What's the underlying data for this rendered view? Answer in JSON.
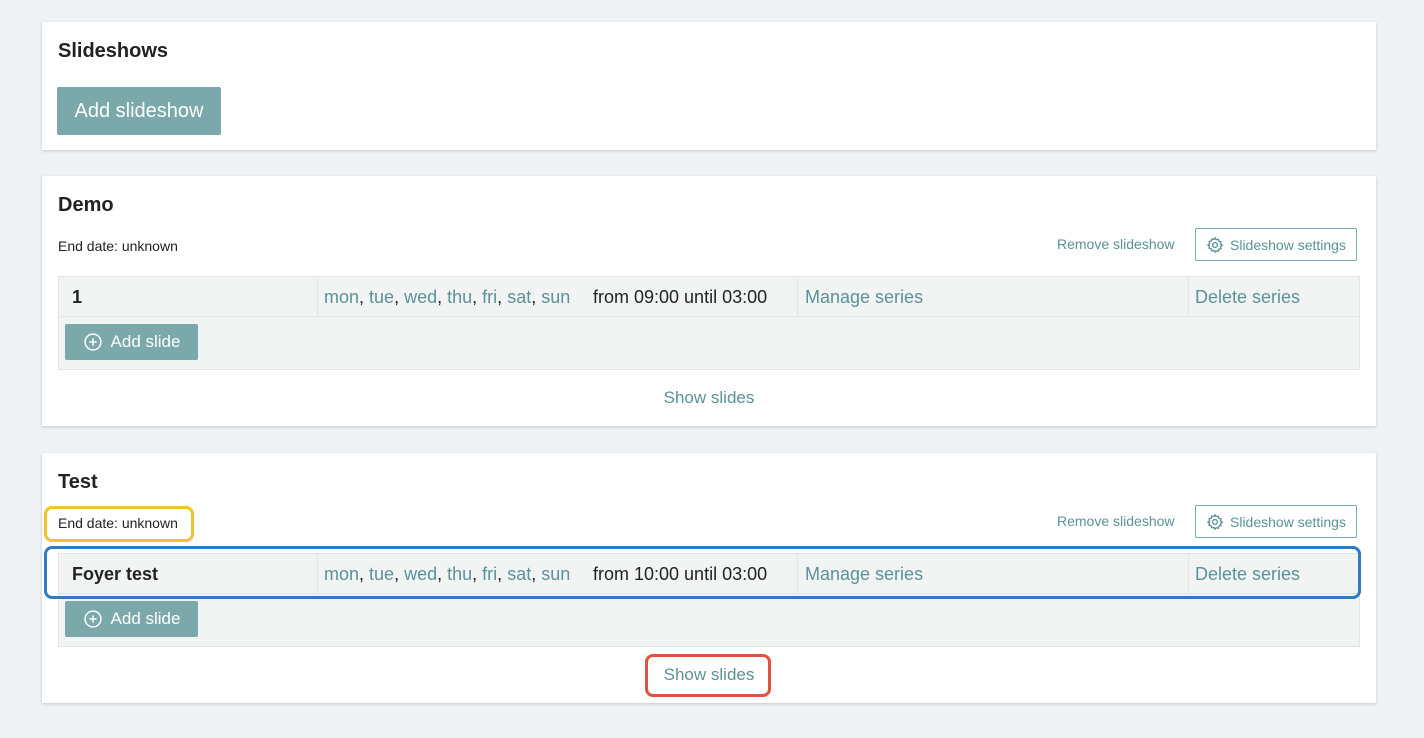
{
  "slideshows_card": {
    "title": "Slideshows",
    "add_button": "Add slideshow"
  },
  "slideshows": [
    {
      "title": "Demo",
      "end_date": "End date: unknown",
      "remove_label": "Remove slideshow",
      "settings_label": "Slideshow settings",
      "series": {
        "name": "1",
        "days": [
          "mon",
          "tue",
          "wed",
          "thu",
          "fri",
          "sat",
          "sun"
        ],
        "time": "from 09:00 until 03:00",
        "manage_label": "Manage series",
        "delete_label": "Delete series"
      },
      "add_slide_label": "Add slide",
      "show_slides_label": "Show slides"
    },
    {
      "title": "Test",
      "end_date": "End date: unknown",
      "remove_label": "Remove slideshow",
      "settings_label": "Slideshow settings",
      "series": {
        "name": "Foyer test",
        "days": [
          "mon",
          "tue",
          "wed",
          "thu",
          "fri",
          "sat",
          "sun"
        ],
        "time": "from 10:00 until 03:00",
        "manage_label": "Manage series",
        "delete_label": "Delete series"
      },
      "add_slide_label": "Add slide",
      "show_slides_label": "Show slides"
    }
  ],
  "colors": {
    "accent": "#7ba8ab",
    "link": "#5a9297",
    "highlight_yellow": "#f2c12e",
    "highlight_blue": "#2f7cc0",
    "highlight_red": "#e0533d"
  }
}
